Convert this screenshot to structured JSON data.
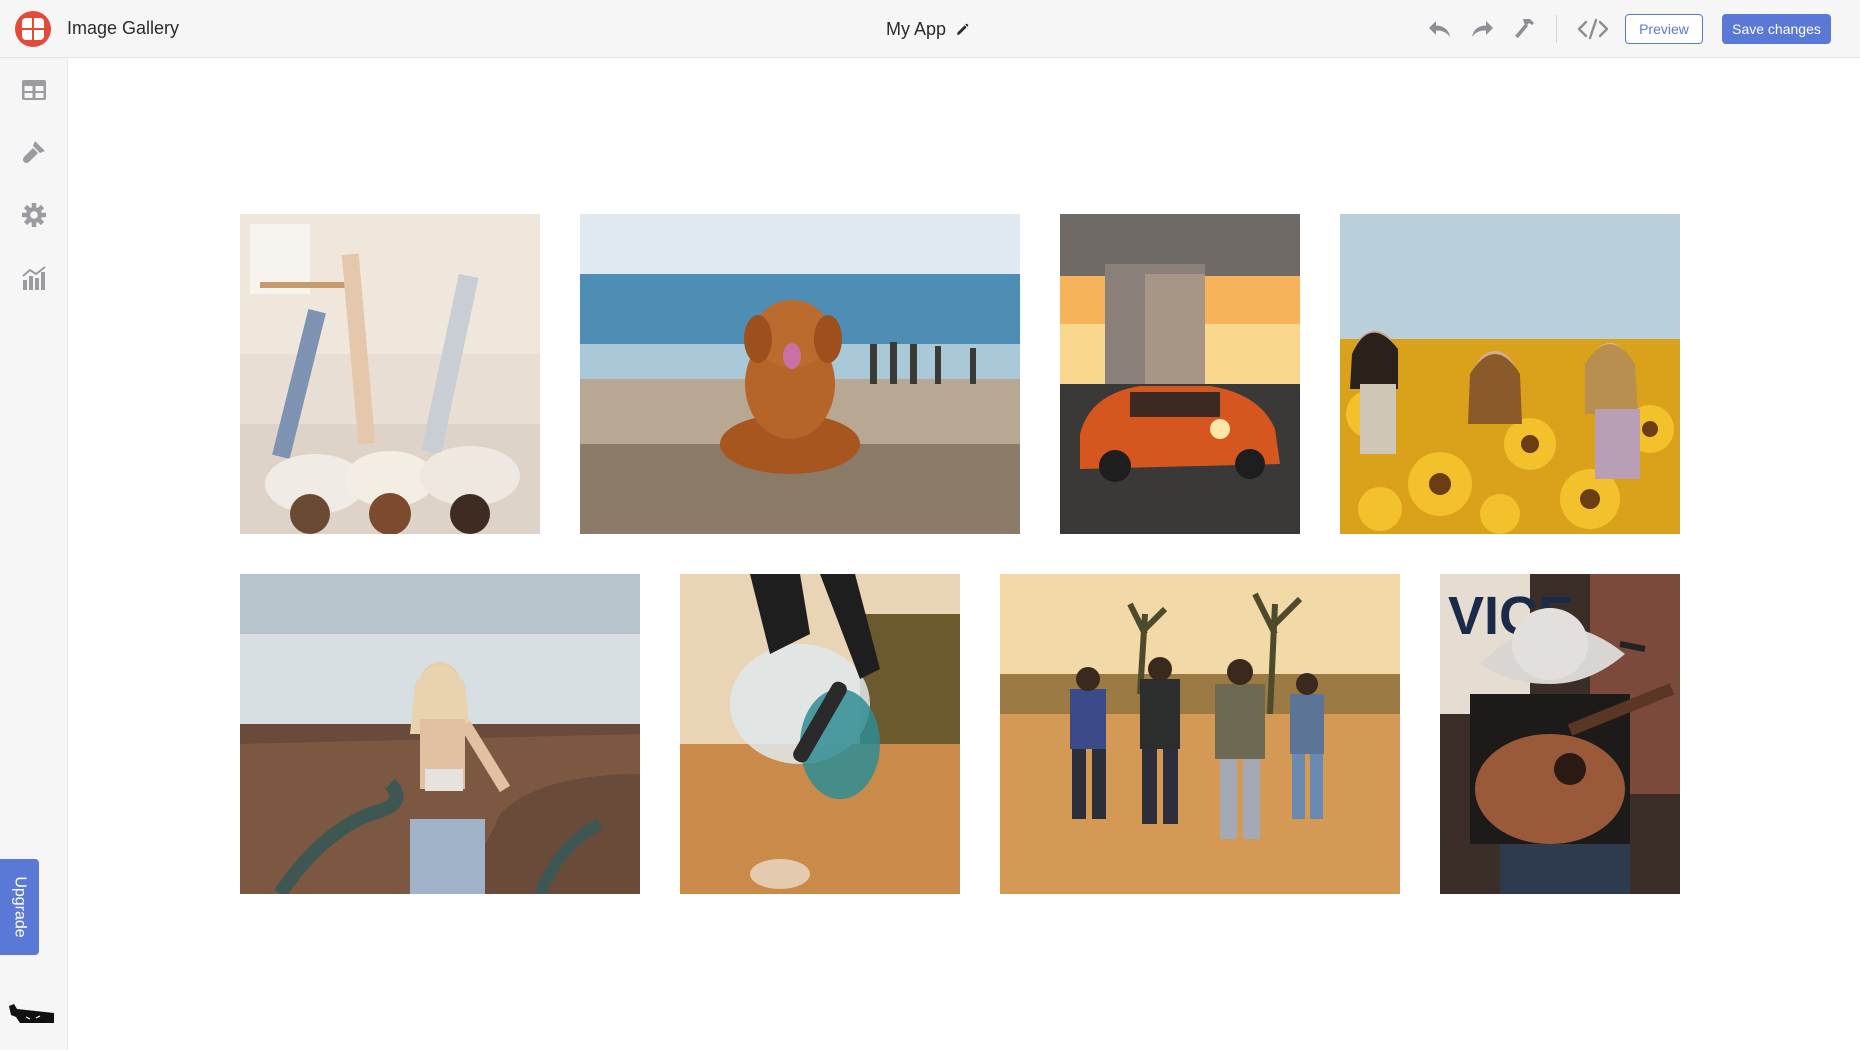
{
  "header": {
    "app_title": "Image Gallery",
    "project_name": "My App",
    "preview_label": "Preview",
    "save_label": "Save changes"
  },
  "sidebar": {
    "upgrade_label": "Upgrade"
  },
  "gallery": {
    "photos": [
      {
        "subject": "three people lying on bed with legs raised"
      },
      {
        "subject": "dog on pebble beach"
      },
      {
        "subject": "orange car under bridge at sunset"
      },
      {
        "subject": "three women in sunflower field"
      },
      {
        "subject": "woman at canyon overlook"
      },
      {
        "subject": "skateboarder jumping with colored powder"
      },
      {
        "subject": "group running in desert at sunset"
      },
      {
        "subject": "musician in cowboy hat playing guitar"
      }
    ]
  },
  "colors": {
    "accent": "#5a78d6",
    "logo": "#e5493a",
    "chrome_bg": "#f6f6f7"
  }
}
